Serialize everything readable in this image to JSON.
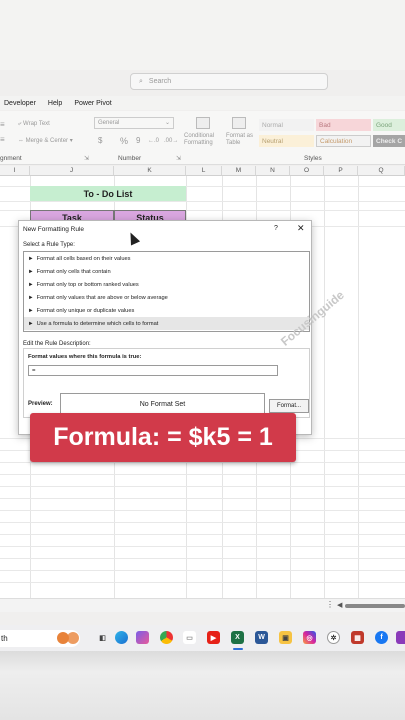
{
  "search": {
    "placeholder": "Search"
  },
  "menubar": {
    "items": [
      "Developer",
      "Help",
      "Power Pivot"
    ]
  },
  "ribbon": {
    "wrap_text": "Wrap Text",
    "merge_center": "Merge & Center",
    "number_format": "General",
    "currency": "$",
    "percent": "%",
    "comma": "9",
    "dec_inc": "←.0",
    "dec_dec": ".00→",
    "conditional_formatting": "Conditional Formatting",
    "format_as_table": "Format as Table",
    "styles": [
      "Normal",
      "Bad",
      "Good",
      "Neutral",
      "Calculation",
      "Check C"
    ],
    "groups": [
      "gnment",
      "Number",
      "Styles"
    ]
  },
  "columns": [
    "I",
    "J",
    "K",
    "L",
    "M",
    "N",
    "O",
    "P",
    "Q"
  ],
  "sheet": {
    "title": "To - Do List",
    "headers": [
      "Task",
      "Status"
    ]
  },
  "dialog": {
    "title": "New Formatting Rule",
    "help": "?",
    "close": "✕",
    "rule_type_label": "Select a Rule Type:",
    "rule_types": [
      "Format all cells based on their values",
      "Format only cells that contain",
      "Format only top or bottom ranked values",
      "Format only values that are above or below average",
      "Format only unique or duplicate values",
      "Use a formula to determine which cells to format"
    ],
    "selected_index": 5,
    "edit_label": "Edit the Rule Description:",
    "formula_label": "Format values where this formula is true:",
    "formula_value": "=",
    "preview_label": "Preview:",
    "preview_text": "No Format Set",
    "format_button": "Format..."
  },
  "watermark": "Focusinguide",
  "banner": "Formula: = $k5 = 1",
  "taskbar": {
    "search_text": "th",
    "icons": [
      "edge-icon",
      "copilot-icon",
      "chrome-icon",
      "youtube-icon",
      "excel-icon",
      "word-icon",
      "store-icon",
      "instagram-icon",
      "chatgpt-icon",
      "facebook-icon",
      "apps-icon"
    ]
  },
  "colors": {
    "banner_red": "#d13a4a",
    "todo_green": "#c6eed0",
    "header_purple": "#d9a6e0"
  }
}
